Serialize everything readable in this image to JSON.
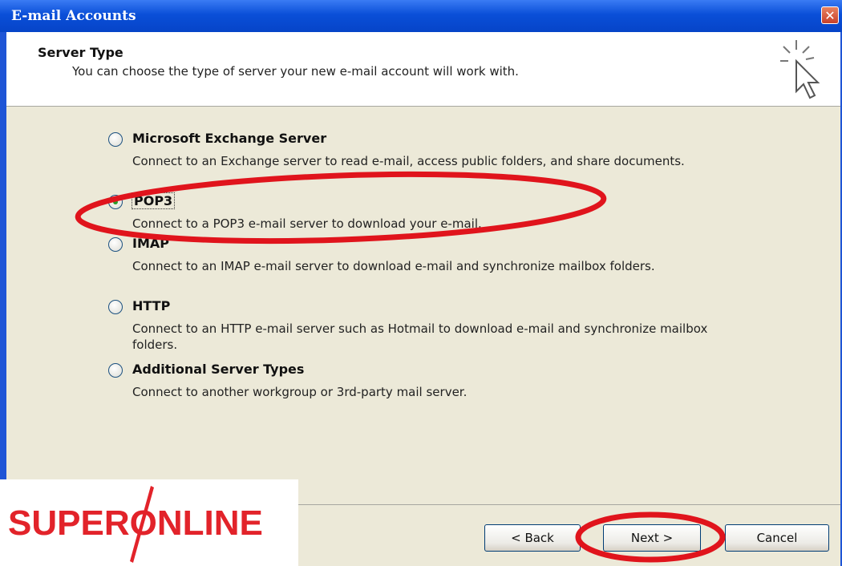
{
  "window": {
    "title": "E-mail Accounts",
    "close_glyph": "✕"
  },
  "header": {
    "title": "Server Type",
    "subtitle": "You can choose the type of server your new e-mail account will work with.",
    "icon": "wizard-cursor-sparkle-icon"
  },
  "options": [
    {
      "label": "Microsoft Exchange Server",
      "description": "Connect to an Exchange server to read e-mail, access public folders, and share documents.",
      "selected": false
    },
    {
      "label": "POP3",
      "description": "Connect to a POP3 e-mail server to download your e-mail.",
      "selected": true
    },
    {
      "label": "IMAP",
      "description": "Connect to an IMAP e-mail server to download e-mail and synchronize mailbox folders.",
      "selected": false
    },
    {
      "label": "HTTP",
      "description": "Connect to an HTTP e-mail server such as Hotmail to download e-mail and synchronize mailbox folders.",
      "selected": false
    },
    {
      "label": "Additional Server Types",
      "description": "Connect to another workgroup or 3rd-party mail server.",
      "selected": false
    }
  ],
  "buttons": {
    "back": "< Back",
    "next": "Next >",
    "cancel": "Cancel"
  },
  "logo": {
    "text": "SUPERONLINE",
    "color": "#e2232a"
  },
  "annotations": {
    "color": "#e0141c",
    "highlighted": [
      "POP3",
      "Next >"
    ]
  },
  "colors": {
    "titlebar": "#0a4fd8",
    "dialog_bg": "#ece9d8",
    "radio_selected": "#2a9d2a"
  }
}
